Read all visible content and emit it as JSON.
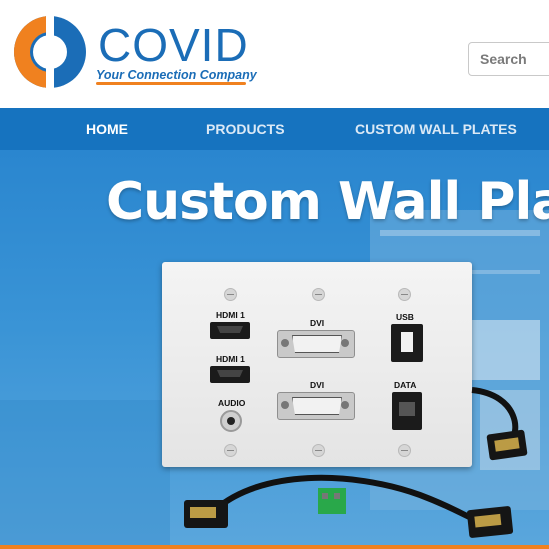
{
  "brand": {
    "name": "COVID",
    "tagline": "Your Connection Company",
    "primary_color": "#1b6db7",
    "accent_color": "#f0811f"
  },
  "search": {
    "placeholder": "Search"
  },
  "nav": {
    "items": [
      {
        "label": "HOME",
        "active": true
      },
      {
        "label": "PRODUCTS"
      },
      {
        "label": "CUSTOM WALL PLATES"
      }
    ]
  },
  "hero": {
    "title": "Custom Wall Plat",
    "ports": {
      "hdmi1_top": "HDMI 1",
      "hdmi1_bottom": "HDMI 1",
      "audio": "AUDIO",
      "dvi_top": "DVI",
      "dvi_bottom": "DVI",
      "usb": "USB",
      "data": "DATA"
    }
  }
}
